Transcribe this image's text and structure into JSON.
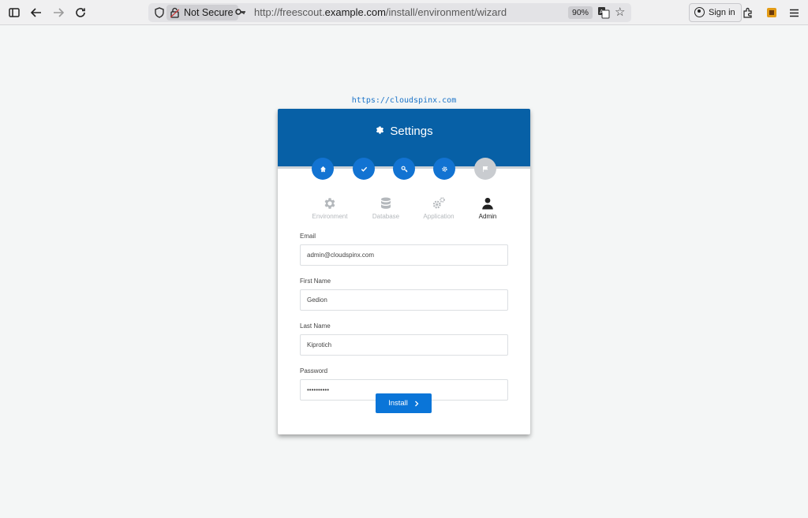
{
  "browser": {
    "security_label": "Not Secure",
    "url_prefix": "http://freescout.",
    "url_domain": "example.com",
    "url_path": "/install/environment/wizard",
    "zoom": "90%",
    "signin_label": "Sign in"
  },
  "page": {
    "site_link": "https://cloudspinx.com",
    "title": "Settings",
    "steps": [
      {
        "icon": "home-icon",
        "state": "done"
      },
      {
        "icon": "check-icon",
        "state": "done"
      },
      {
        "icon": "key-icon",
        "state": "done"
      },
      {
        "icon": "gear-icon",
        "state": "done"
      },
      {
        "icon": "flag-icon",
        "state": "pending"
      }
    ],
    "tabs": [
      {
        "label": "Environment",
        "icon": "gear-icon",
        "active": false
      },
      {
        "label": "Database",
        "icon": "database-icon",
        "active": false
      },
      {
        "label": "Application",
        "icon": "gears-icon",
        "active": false
      },
      {
        "label": "Admin",
        "icon": "user-icon",
        "active": true
      }
    ],
    "form": {
      "email_label": "Email",
      "email_value": "admin@cloudspinx.com",
      "first_name_label": "First Name",
      "first_name_value": "Gedion",
      "last_name_label": "Last Name",
      "last_name_value": "Kiprotich",
      "password_label": "Password",
      "password_value": "••••••••••"
    },
    "install_label": "Install"
  }
}
